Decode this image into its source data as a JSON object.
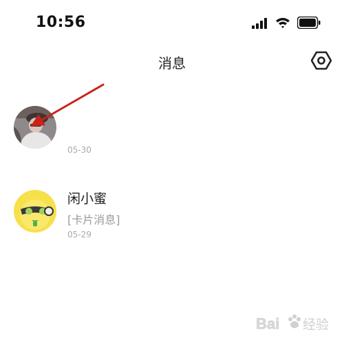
{
  "status_bar": {
    "time": "10:56"
  },
  "header": {
    "title": "消息",
    "settings_icon": "settings-hexagon-icon"
  },
  "messages": [
    {
      "name": "",
      "preview": "",
      "date": "05-30",
      "avatar": "user-photo-avatar"
    },
    {
      "name": "闲小蜜",
      "preview": "[卡片消息]",
      "date": "05-29",
      "avatar": "xianxiaomi-bot-avatar"
    }
  ],
  "colors": {
    "annotation_arrow": "#c8231a",
    "secondary_text": "#9a9a9a"
  },
  "watermark": {
    "text": "Bai 经验"
  }
}
